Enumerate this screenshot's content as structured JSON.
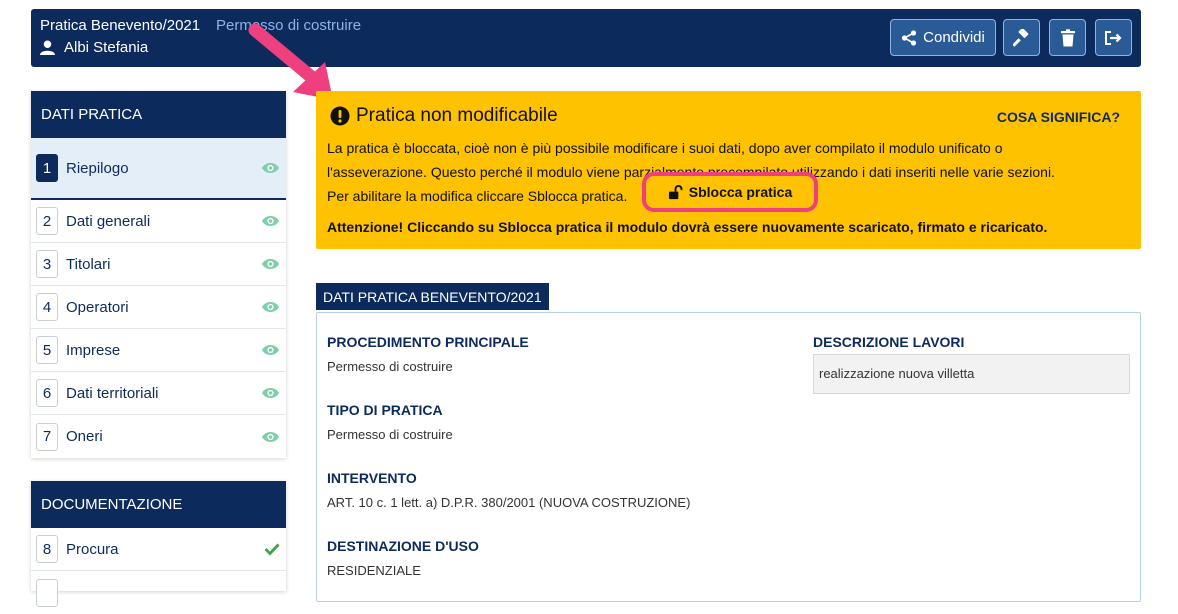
{
  "header": {
    "title": "Pratica Benevento/2021",
    "subtitle": "Permesso di costruire",
    "user": "Albi Stefania",
    "share_label": "Condividi"
  },
  "sidebar": {
    "dati_pratica_title": "DATI PRATICA",
    "items": [
      {
        "num": "1",
        "label": "Riepilogo"
      },
      {
        "num": "2",
        "label": "Dati generali"
      },
      {
        "num": "3",
        "label": "Titolari"
      },
      {
        "num": "4",
        "label": "Operatori"
      },
      {
        "num": "5",
        "label": "Imprese"
      },
      {
        "num": "6",
        "label": "Dati territoriali"
      },
      {
        "num": "7",
        "label": "Oneri"
      }
    ],
    "documentazione_title": "DOCUMENTAZIONE",
    "doc_items": [
      {
        "num": "8",
        "label": "Procura"
      }
    ]
  },
  "alert": {
    "title": "Pratica non modificabile",
    "link": "COSA SIGNIFICA?",
    "text_line1": "La pratica è bloccata, cioè non è più possibile modificare i suoi dati, dopo aver compilato il modulo unificato o",
    "text_line2": "l'asseverazione. Questo perché il modulo viene parzialmente precompilato utilizzando i dati inseriti nelle varie sezioni.",
    "text_line3": "Per abilitare la modifica cliccare Sblocca pratica.",
    "unlock_label": "Sblocca pratica",
    "warning": "Attenzione! Cliccando su Sblocca pratica il modulo dovrà essere nuovamente scaricato, firmato e ricaricato."
  },
  "section": {
    "tab": "DATI PRATICA BENEVENTO/2021",
    "procedimento_label": "PROCEDIMENTO PRINCIPALE",
    "procedimento_value": "Permesso di costruire",
    "tipo_label": "TIPO DI PRATICA",
    "tipo_value": "Permesso di costruire",
    "intervento_label": "INTERVENTO",
    "intervento_value": "ART. 10 c. 1 lett. a) D.P.R. 380/2001 (NUOVA COSTRUZIONE)",
    "destinazione_label": "DESTINAZIONE D'USO",
    "destinazione_value": "RESIDENZIALE",
    "descrizione_label": "DESCRIZIONE LAVORI",
    "descrizione_value": "realizzazione nuova villetta"
  },
  "colors": {
    "navy": "#0d2a5c",
    "alert_yellow": "#ffc200",
    "highlight_pink": "#ee3f7f",
    "eye_green": "#7ccfa8",
    "check_green": "#3fa34d"
  },
  "icons": [
    "user-icon",
    "share-icon",
    "hammer-icon",
    "trash-icon",
    "exit-icon",
    "exclamation-icon",
    "unlock-icon",
    "eye-icon",
    "check-icon",
    "arrow-annotation"
  ]
}
